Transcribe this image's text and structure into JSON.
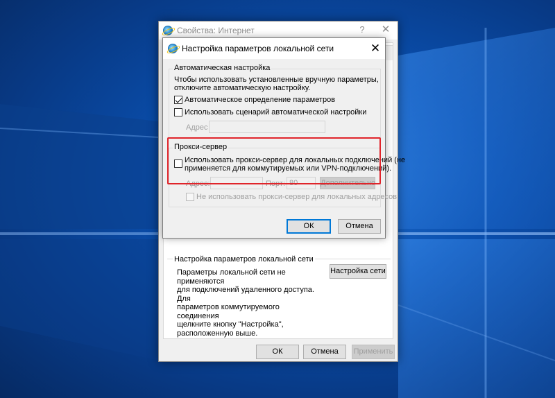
{
  "parent_window": {
    "title": "Свойства: Интернет",
    "help_glyph": "?",
    "close_glyph": "✕",
    "lan_section": {
      "title": "Настройка параметров локальной сети",
      "description": "Параметры локальной сети не применяются\nдля подключений удаленного доступа. Для\nпараметров коммутируемого соединения\nщелкните кнопку \"Настройка\",\nрасположенную выше.",
      "lan_settings_button": "Настройка сети"
    },
    "buttons": {
      "ok": "ОК",
      "cancel": "Отмена",
      "apply": "Применить"
    }
  },
  "dialog": {
    "title": "Настройка параметров локальной сети",
    "close_glyph": "✕",
    "auto_config": {
      "group_title": "Автоматическая настройка",
      "description_line1": "Чтобы использовать установленные вручную параметры,",
      "description_line2": "отключите автоматическую настройку.",
      "auto_detect_label": "Автоматическое определение параметров",
      "auto_detect_checked": true,
      "use_script_label": "Использовать сценарий автоматической настройки",
      "use_script_checked": false,
      "address_label": "Адрес",
      "address_value": ""
    },
    "proxy": {
      "group_title": "Прокси-сервер",
      "use_proxy_label_line1": "Использовать прокси-сервер для локальных подключений (не",
      "use_proxy_label_line2": "применяется для коммутируемых или VPN-подключений).",
      "use_proxy_checked": false,
      "address_label": "Адрес:",
      "address_value": "",
      "port_label": "Порт:",
      "port_value": "80",
      "advanced_button": "Дополнительно",
      "bypass_local_label": "Не использовать прокси-сервер для локальных адресов",
      "bypass_local_checked": false
    },
    "buttons": {
      "ok": "ОК",
      "cancel": "Отмена"
    }
  },
  "colors": {
    "desktop_blue": "#0a4fae",
    "highlight_red": "#e0242a",
    "focus_blue": "#0078d7"
  }
}
